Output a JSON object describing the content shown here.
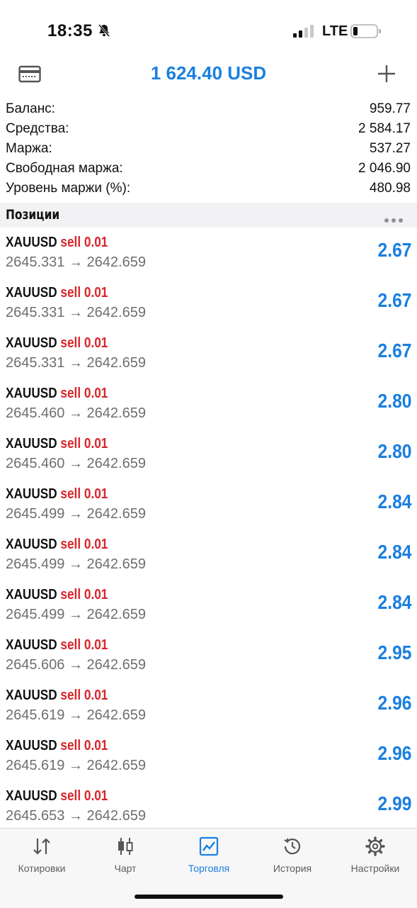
{
  "status_bar": {
    "time": "18:35",
    "network": "LTE",
    "icons": [
      "bell-slash-icon",
      "signal-icon",
      "battery-icon"
    ]
  },
  "header": {
    "title": "1 624.40 USD",
    "left_icon": "credit-card-icon",
    "right_icon": "plus-icon"
  },
  "summary": [
    {
      "label": "Баланс:",
      "value": "959.77"
    },
    {
      "label": "Средства:",
      "value": "2 584.17"
    },
    {
      "label": "Маржа:",
      "value": "537.27"
    },
    {
      "label": "Свободная маржа:",
      "value": "2 046.90"
    },
    {
      "label": "Уровень маржи (%):",
      "value": "480.98"
    }
  ],
  "positions_section": {
    "title": "Позиции",
    "more_icon": "more-horizontal-icon"
  },
  "positions": [
    {
      "symbol": "XAUUSD",
      "type": "sell 0.01",
      "prices": "2645.331 → 2642.659",
      "profit": "2.67"
    },
    {
      "symbol": "XAUUSD",
      "type": "sell 0.01",
      "prices": "2645.331 → 2642.659",
      "profit": "2.67"
    },
    {
      "symbol": "XAUUSD",
      "type": "sell 0.01",
      "prices": "2645.331 → 2642.659",
      "profit": "2.67"
    },
    {
      "symbol": "XAUUSD",
      "type": "sell 0.01",
      "prices": "2645.460 → 2642.659",
      "profit": "2.80"
    },
    {
      "symbol": "XAUUSD",
      "type": "sell 0.01",
      "prices": "2645.460 → 2642.659",
      "profit": "2.80"
    },
    {
      "symbol": "XAUUSD",
      "type": "sell 0.01",
      "prices": "2645.499 → 2642.659",
      "profit": "2.84"
    },
    {
      "symbol": "XAUUSD",
      "type": "sell 0.01",
      "prices": "2645.499 → 2642.659",
      "profit": "2.84"
    },
    {
      "symbol": "XAUUSD",
      "type": "sell 0.01",
      "prices": "2645.499 → 2642.659",
      "profit": "2.84"
    },
    {
      "symbol": "XAUUSD",
      "type": "sell 0.01",
      "prices": "2645.606 → 2642.659",
      "profit": "2.95"
    },
    {
      "symbol": "XAUUSD",
      "type": "sell 0.01",
      "prices": "2645.619 → 2642.659",
      "profit": "2.96"
    },
    {
      "symbol": "XAUUSD",
      "type": "sell 0.01",
      "prices": "2645.619 → 2642.659",
      "profit": "2.96"
    },
    {
      "symbol": "XAUUSD",
      "type": "sell 0.01",
      "prices": "2645.653 → 2642.659",
      "profit": "2.99"
    }
  ],
  "tabs": [
    {
      "label": "Котировки",
      "icon": "quotes-arrows-icon"
    },
    {
      "label": "Чарт",
      "icon": "candlestick-chart-icon"
    },
    {
      "label": "Торговля",
      "icon": "trade-chart-icon",
      "active": true
    },
    {
      "label": "История",
      "icon": "history-clock-icon"
    },
    {
      "label": "Настройки",
      "icon": "gear-icon"
    }
  ],
  "colors": {
    "accent": "#1a7fe0",
    "sell": "#d8262b",
    "muted": "#6e6e73"
  }
}
